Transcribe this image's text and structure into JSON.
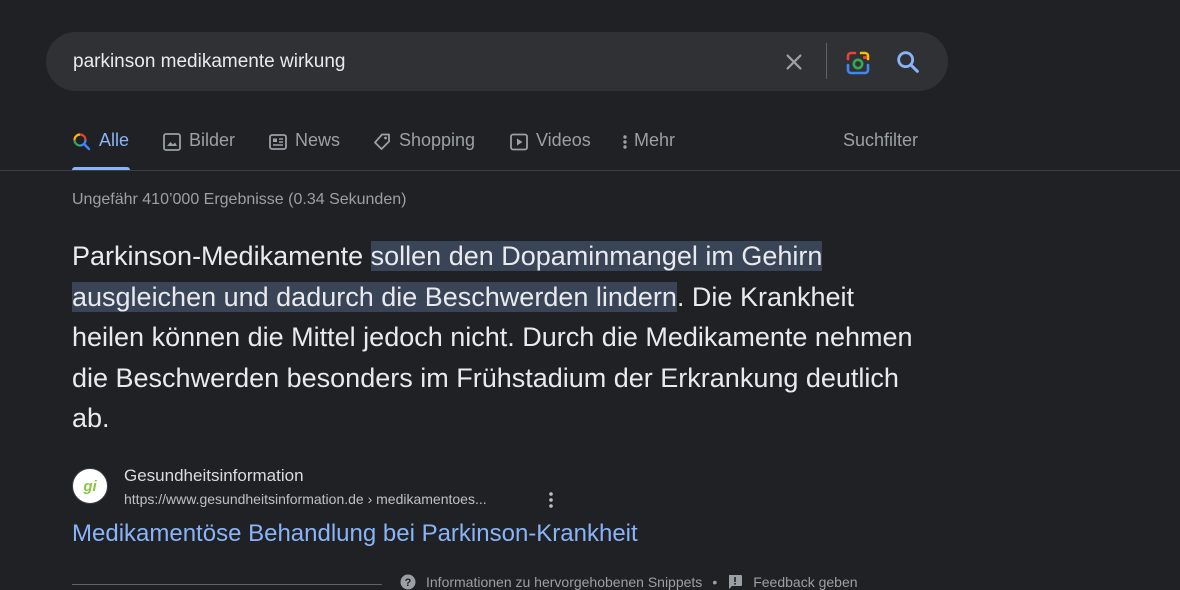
{
  "search": {
    "query": "parkinson medikamente wirkung"
  },
  "tabs": [
    {
      "label": "Alle",
      "icon": "search-multicolor-icon",
      "active": true
    },
    {
      "label": "Bilder",
      "icon": "image-icon"
    },
    {
      "label": "News",
      "icon": "news-icon"
    },
    {
      "label": "Shopping",
      "icon": "tag-icon"
    },
    {
      "label": "Videos",
      "icon": "play-icon"
    },
    {
      "label": "Mehr",
      "icon": "more-vert-icon"
    }
  ],
  "tools_label": "Suchfilter",
  "stats": "Ungefähr 410’000 Ergebnisse (0.34 Sekunden)",
  "snippet": {
    "before": "Parkinson-Medikamente ",
    "highlight": "sollen den Dopaminmangel im Gehirn ausgleichen und dadurch die Beschwerden lindern",
    "after": ". Die Krankheit heilen können die Mittel jedoch nicht. Durch die Medikamente nehmen die Beschwerden besonders im Frühstadium der Erkrankung deutlich ab."
  },
  "source": {
    "favicon_text": "gi",
    "name": "Gesundheitsinformation",
    "url": "https://www.gesundheitsinformation.de › medikamentoes..."
  },
  "result_title": "Medikamentöse Behandlung bei Parkinson-Krankheit",
  "footer": {
    "info_label": "Informationen zu hervorgehobenen Snippets",
    "separator": "•",
    "feedback_label": "Feedback geben"
  },
  "colors": {
    "background": "#202124",
    "accent": "#8ab4f8",
    "highlight": "#394457"
  }
}
